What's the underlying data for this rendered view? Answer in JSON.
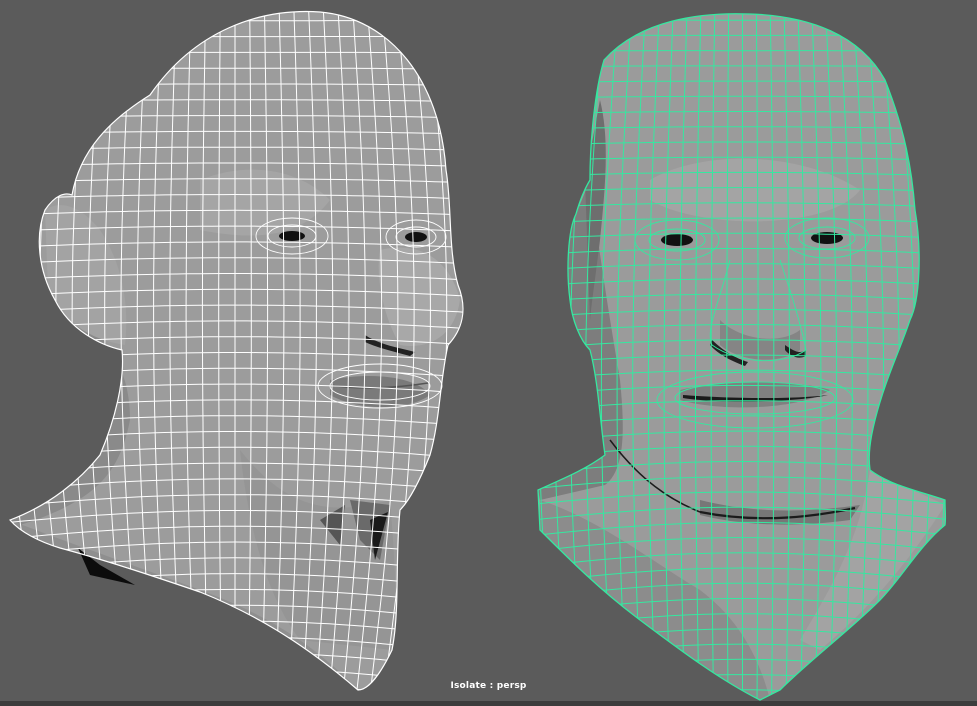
{
  "viewport": {
    "hud_text": "Isolate : persp",
    "background_color": "#5b5b5b"
  },
  "left_head": {
    "mode": "wireframe-on-shaded",
    "wire_color": "#ffffff",
    "shade_color": "#9a9a9a"
  },
  "right_head": {
    "mode": "wireframe-on-shaded-selected",
    "wire_color": "#35e8a0",
    "shade_color": "#9a9a9a"
  }
}
